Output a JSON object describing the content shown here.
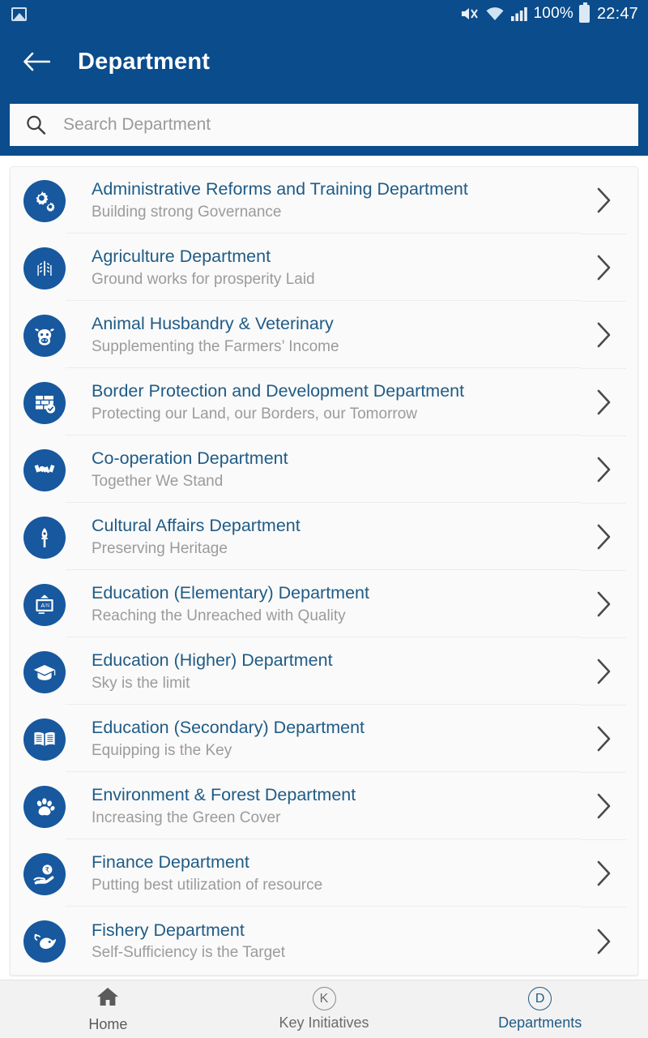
{
  "status_bar": {
    "left_icon": "gallery-icon",
    "icons": [
      "mute-icon",
      "wifi-icon",
      "signal-icon"
    ],
    "battery_percent": "100%",
    "battery_icon": "battery-full-icon",
    "clock": "22:47"
  },
  "header": {
    "back_icon": "back-arrow-icon",
    "title": "Department"
  },
  "search": {
    "icon": "search-icon",
    "placeholder": "Search Department",
    "value": ""
  },
  "colors": {
    "header_blue": "#0b4c8c",
    "icon_blue": "#17589e",
    "title_blue": "#1f5b86",
    "subtitle_gray": "#9b9b9b",
    "card_bg": "#fafafa"
  },
  "departments": [
    {
      "title": "Administrative Reforms and Training Department",
      "subtitle": "Building strong Governance",
      "icon": "gears-icon"
    },
    {
      "title": "Agriculture Department",
      "subtitle": "Ground works for prosperity Laid",
      "icon": "wheat-icon"
    },
    {
      "title": "Animal Husbandry & Veterinary",
      "subtitle": "Supplementing the Farmers’ Income",
      "icon": "cow-icon"
    },
    {
      "title": "Border Protection and Development Department",
      "subtitle": "Protecting our Land, our Borders, our Tomorrow",
      "icon": "wall-check-icon"
    },
    {
      "title": "Co-operation Department",
      "subtitle": "Together We Stand",
      "icon": "handshake-icon"
    },
    {
      "title": "Cultural Affairs Department",
      "subtitle": "Preserving Heritage",
      "icon": "pen-nib-icon"
    },
    {
      "title": "Education (Elementary) Department",
      "subtitle": "Reaching the Unreached with Quality",
      "icon": "blackboard-icon"
    },
    {
      "title": "Education (Higher) Department",
      "subtitle": "Sky is the limit",
      "icon": "graduation-cap-icon"
    },
    {
      "title": "Education (Secondary) Department",
      "subtitle": "Equipping is the Key",
      "icon": "open-book-icon"
    },
    {
      "title": "Environment & Forest Department",
      "subtitle": "Increasing the Green Cover",
      "icon": "paw-print-icon"
    },
    {
      "title": "Finance Department",
      "subtitle": "Putting best utilization of resource",
      "icon": "hand-rupee-icon"
    },
    {
      "title": "Fishery Department",
      "subtitle": "Self-Sufficiency is the Target",
      "icon": "fish-icon"
    }
  ],
  "bottom_nav": [
    {
      "label": "Home",
      "icon": "home-icon",
      "active": false
    },
    {
      "label": "Key Initiatives",
      "icon": "letter-k-circle-icon",
      "active": false
    },
    {
      "label": "Departments",
      "icon": "letter-d-circle-icon",
      "active": true
    }
  ]
}
